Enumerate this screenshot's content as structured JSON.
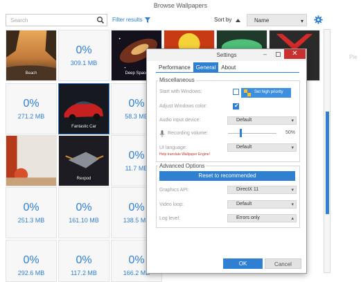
{
  "window": {
    "title": "Browse Wallpapers"
  },
  "toolbar": {
    "search_placeholder": "Search",
    "filter_label": "Filter results",
    "sort_by_label": "Sort by",
    "sort_value": "Name",
    "sort_direction": "ascending"
  },
  "side_hint": "Ple",
  "tiles": [
    {
      "type": "image",
      "caption": "Beach"
    },
    {
      "type": "download",
      "percent": "0%",
      "size": "309.1 MB"
    },
    {
      "type": "image",
      "caption": "Deep Space"
    },
    {
      "type": "download",
      "percent": "0%",
      "size": "271.2 MB"
    },
    {
      "type": "image",
      "caption": "Fantastic Car"
    },
    {
      "type": "download",
      "percent": "0%",
      "size": "58.3 MB"
    },
    {
      "type": "image",
      "caption": ""
    },
    {
      "type": "image",
      "caption": "Rexpod"
    },
    {
      "type": "download",
      "percent": "0%",
      "size": "11.7 MB"
    },
    {
      "type": "download",
      "percent": "0%",
      "size": "251.3 MB"
    },
    {
      "type": "download",
      "percent": "0%",
      "size": "161.10 MB"
    },
    {
      "type": "download",
      "percent": "0%",
      "size": "138.5 MB"
    },
    {
      "type": "download",
      "percent": "0%",
      "size": "292.6 MB"
    },
    {
      "type": "download",
      "percent": "0%",
      "size": "117.2 MB"
    },
    {
      "type": "download",
      "percent": "0%",
      "size": "166.2 MB"
    }
  ],
  "settings": {
    "title": "Settings",
    "tabs": [
      "Performance",
      "General",
      "About"
    ],
    "active_tab": "General",
    "misc": {
      "title": "Miscellaneous",
      "start_with_windows": "Start with Windows:",
      "start_with_windows_checked": false,
      "high_priority_label": "Set high priority",
      "adjust_color": "Adjust Windows color:",
      "adjust_color_checked": true,
      "audio_input": "Audio input device:",
      "audio_input_value": "Default",
      "recording_volume": "Recording volume:",
      "recording_volume_value": "50%",
      "ui_language": "UI language:",
      "ui_language_value": "Default",
      "translate_link": "Help translate Wallpaper Engine!"
    },
    "advanced": {
      "title": "Advanced Options",
      "reset_label": "Reset to recommended",
      "graphics_api": "Graphics API:",
      "graphics_api_value": "DirectX 11",
      "video_loop": "Video loop:",
      "video_loop_value": "Default",
      "log_level": "Log level:",
      "log_level_value": "Errors only"
    },
    "ok_label": "OK",
    "cancel_label": "Cancel"
  },
  "colors": {
    "accent": "#2f7fd3",
    "close": "#c8312f"
  }
}
